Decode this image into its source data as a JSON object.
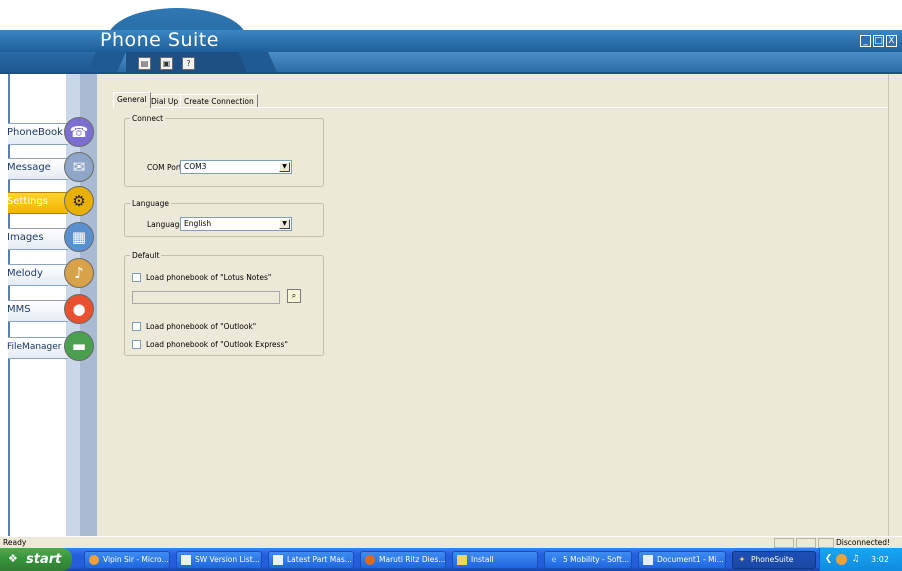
{
  "window": {
    "title": "Phone Suite",
    "controls": {
      "minimize": "_",
      "maximize": "□",
      "close": "X"
    }
  },
  "toolbar": {
    "buttons": [
      {
        "name": "document-icon",
        "glyph": "▤"
      },
      {
        "name": "properties-icon",
        "glyph": "▣"
      },
      {
        "name": "help-icon",
        "glyph": "?"
      }
    ]
  },
  "sidebar": {
    "items": [
      {
        "label": "PhoneBook",
        "icon": "phone-icon",
        "glyph": "☎",
        "active": false
      },
      {
        "label": "Message",
        "icon": "envelope-icon",
        "glyph": "✉",
        "active": false
      },
      {
        "label": "Settings",
        "icon": "settings-icon",
        "glyph": "⚙",
        "active": true
      },
      {
        "label": "Images",
        "icon": "image-icon",
        "glyph": "▦",
        "active": false
      },
      {
        "label": "Melody",
        "icon": "music-note-icon",
        "glyph": "♪",
        "active": false
      },
      {
        "label": "MMS",
        "icon": "balloon-icon",
        "glyph": "●",
        "active": false
      },
      {
        "label": "FileManager",
        "icon": "folder-icon",
        "glyph": "▬",
        "active": false
      }
    ]
  },
  "tabs": [
    {
      "label": "General",
      "active": true
    },
    {
      "label": "Dial Up",
      "active": false
    },
    {
      "label": "Create Connection",
      "active": false
    }
  ],
  "connect": {
    "legend": "Connect",
    "com_port_label": "COM Port:",
    "com_port_value": "COM3"
  },
  "language": {
    "legend": "Language",
    "language_label": "Language:",
    "language_value": "English"
  },
  "default": {
    "legend": "Default",
    "lotus_label": "Load phonebook of \"Lotus Notes\"",
    "lotus_path": "",
    "outlook_label": "Load phonebook of \"Outlook\"",
    "outlook_express_label": "Load phonebook of \"Outlook Express\""
  },
  "statusbar": {
    "left": "Ready",
    "right": "Disconnected!"
  },
  "taskbar": {
    "start_label": "start",
    "tasks": [
      {
        "label": "Vipin Sir - Micro...",
        "icon": "outlook-icon",
        "active": false
      },
      {
        "label": "SW Version List...",
        "icon": "excel-icon",
        "active": false
      },
      {
        "label": "Latest Part Mas...",
        "icon": "excel-icon",
        "active": false
      },
      {
        "label": "Maruti Ritz Dies...",
        "icon": "firefox-icon",
        "active": false
      },
      {
        "label": "Install",
        "icon": "folder-icon",
        "active": false
      },
      {
        "label": "5 Mobility - Soft...",
        "icon": "ie-icon",
        "active": false
      },
      {
        "label": "Document1 - Mi...",
        "icon": "word-icon",
        "active": false
      },
      {
        "label": "PhoneSuite",
        "icon": "phonesuite-icon",
        "active": true
      }
    ],
    "clock": "3:02 PM"
  }
}
